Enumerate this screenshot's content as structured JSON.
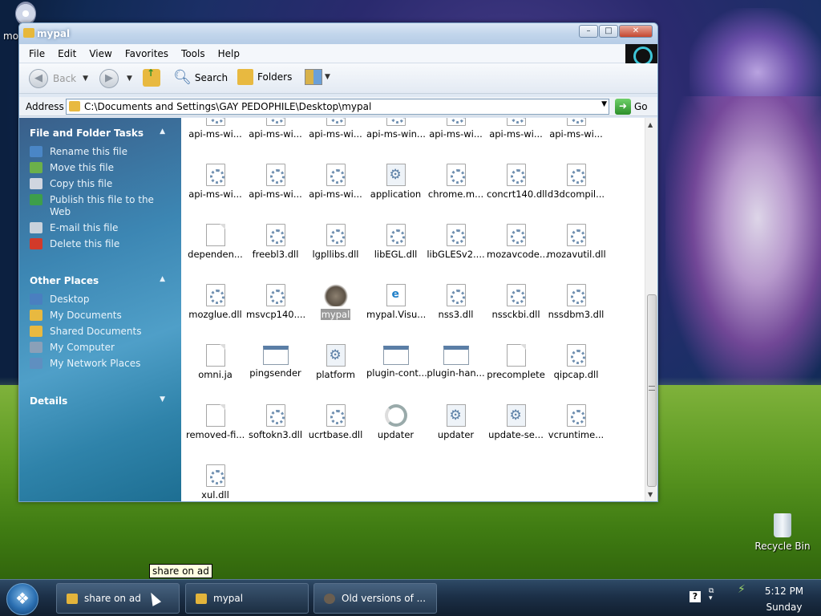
{
  "desktop": {
    "top_icon_label": "mo",
    "recycle_bin_label": "Recycle Bin"
  },
  "window": {
    "title": "mypal",
    "controls": {
      "minimize": "–",
      "maximize": "□",
      "close": "✕"
    }
  },
  "menu": [
    "File",
    "Edit",
    "View",
    "Favorites",
    "Tools",
    "Help"
  ],
  "toolbar": {
    "back_label": "Back",
    "search_label": "Search",
    "folders_label": "Folders"
  },
  "address": {
    "label": "Address",
    "path": "C:\\Documents and Settings\\GAY PEDOPHILE\\Desktop\\mypal",
    "go_label": "Go"
  },
  "taskpane": {
    "file_tasks": {
      "title": "File and Folder Tasks",
      "items": [
        {
          "label": "Rename this file",
          "color": "#4a86c6"
        },
        {
          "label": "Move this file",
          "color": "#6bb04a"
        },
        {
          "label": "Copy this file",
          "color": "#d0d6e0"
        },
        {
          "label": "Publish this file to the Web",
          "color": "#3d9e4a"
        },
        {
          "label": "E-mail this file",
          "color": "#c9d2dc"
        },
        {
          "label": "Delete this file",
          "color": "#d23a2a"
        }
      ]
    },
    "other_places": {
      "title": "Other Places",
      "items": [
        {
          "label": "Desktop",
          "color": "#4a7fc0"
        },
        {
          "label": "My Documents",
          "color": "#e8b940"
        },
        {
          "label": "Shared Documents",
          "color": "#e8b940"
        },
        {
          "label": "My Computer",
          "color": "#8aa0b8"
        },
        {
          "label": "My Network Places",
          "color": "#5f8fc0"
        }
      ]
    },
    "details": {
      "title": "Details"
    }
  },
  "files": [
    {
      "label": "api-ms-wi...",
      "icon": "dll"
    },
    {
      "label": "api-ms-wi...",
      "icon": "dll"
    },
    {
      "label": "api-ms-wi...",
      "icon": "dll"
    },
    {
      "label": "api-ms-win...",
      "icon": "dll"
    },
    {
      "label": "api-ms-wi...",
      "icon": "dll"
    },
    {
      "label": "api-ms-wi...",
      "icon": "dll"
    },
    {
      "label": "api-ms-wi...",
      "icon": "dll"
    },
    {
      "label": "api-ms-wi...",
      "icon": "dll"
    },
    {
      "label": "api-ms-wi...",
      "icon": "dll"
    },
    {
      "label": "api-ms-wi...",
      "icon": "dll"
    },
    {
      "label": "application",
      "icon": "gear"
    },
    {
      "label": "chrome.m...",
      "icon": "dll"
    },
    {
      "label": "concrt140.dll",
      "icon": "dll"
    },
    {
      "label": "d3dcompil...",
      "icon": "dll"
    },
    {
      "label": "dependen...",
      "icon": "doc"
    },
    {
      "label": "freebl3.dll",
      "icon": "dll"
    },
    {
      "label": "lgpllibs.dll",
      "icon": "dll"
    },
    {
      "label": "libEGL.dll",
      "icon": "dll"
    },
    {
      "label": "libGLESv2....",
      "icon": "dll"
    },
    {
      "label": "mozavcode...",
      "icon": "dll"
    },
    {
      "label": "mozavutil.dll",
      "icon": "dll"
    },
    {
      "label": "mozglue.dll",
      "icon": "dll"
    },
    {
      "label": "msvcp140....",
      "icon": "dll"
    },
    {
      "label": "mypal",
      "icon": "raccoon",
      "selected": true
    },
    {
      "label": "mypal.Visu...",
      "icon": "xml"
    },
    {
      "label": "nss3.dll",
      "icon": "dll"
    },
    {
      "label": "nssckbi.dll",
      "icon": "dll"
    },
    {
      "label": "nssdbm3.dll",
      "icon": "dll"
    },
    {
      "label": "omni.ja",
      "icon": "doc"
    },
    {
      "label": "pingsender",
      "icon": "app"
    },
    {
      "label": "platform",
      "icon": "gear"
    },
    {
      "label": "plugin-cont...",
      "icon": "app"
    },
    {
      "label": "plugin-han...",
      "icon": "app"
    },
    {
      "label": "precomplete",
      "icon": "doc"
    },
    {
      "label": "qipcap.dll",
      "icon": "dll"
    },
    {
      "label": "removed-fi...",
      "icon": "doc"
    },
    {
      "label": "softokn3.dll",
      "icon": "dll"
    },
    {
      "label": "ucrtbase.dll",
      "icon": "dll"
    },
    {
      "label": "updater",
      "icon": "update"
    },
    {
      "label": "updater",
      "icon": "gear"
    },
    {
      "label": "update-se...",
      "icon": "gear"
    },
    {
      "label": "vcruntime...",
      "icon": "dll"
    },
    {
      "label": "xul.dll",
      "icon": "dll"
    }
  ],
  "taskbar": {
    "tasks": [
      {
        "label": "share on ad"
      },
      {
        "label": "mypal"
      },
      {
        "label": "Old versions of ..."
      }
    ],
    "tooltip": "share on ad",
    "clock_time": "5:12 PM",
    "clock_day": "Sunday"
  }
}
